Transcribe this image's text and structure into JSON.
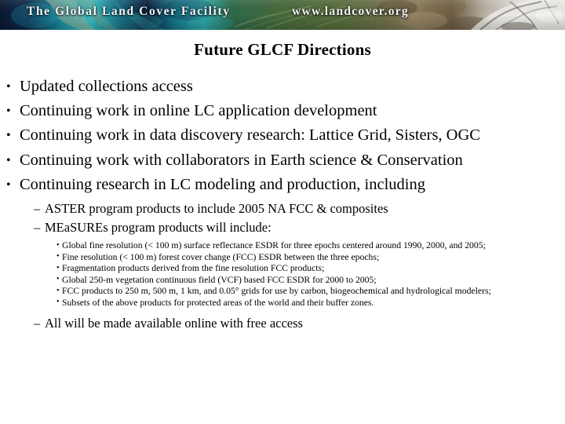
{
  "banner": {
    "title": "The Global Land Cover Facility",
    "url": "www.landcover.org",
    "colors": {
      "ocean_dark": "#0b1d3a",
      "ocean_teal": "#1fa0a8",
      "ocean_cyan": "#3fc7c9",
      "land_green": "#4d6b3a",
      "land_tan": "#8d7a5a",
      "snow_white": "#e8e8e6",
      "text": "#f2f6f8"
    }
  },
  "slide": {
    "title": "Future GLCF Directions"
  },
  "bullets": [
    {
      "text": "Updated collections access"
    },
    {
      "text": "Continuing work in online LC application development"
    },
    {
      "text": "Continuing work in data discovery research: Lattice Grid, Sisters, OGC"
    },
    {
      "text": "Continuing work with collaborators in Earth science & Conservation"
    },
    {
      "text": "Continuing research in LC modeling and production, including"
    }
  ],
  "sub_bullets": [
    {
      "text": "ASTER program products to include 2005 NA FCC & composites"
    },
    {
      "text": "MEaSUREs program products will include:"
    }
  ],
  "detail_bullets": [
    {
      "text": "Global fine resolution (< 100 m) surface reflectance ESDR for three epochs centered around 1990, 2000, and 2005;"
    },
    {
      "text": "Fine resolution (< 100 m) forest cover change (FCC) ESDR between the three epochs;"
    },
    {
      "text": "Fragmentation products derived from the fine resolution FCC products;"
    },
    {
      "text": "Global 250-m vegetation continuous field (VCF) based FCC ESDR for 2000 to 2005;"
    },
    {
      "text": "FCC products to 250 m, 500 m, 1 km, and 0.05° grids for use by carbon, biogeochemical and hydrological modelers;"
    },
    {
      "text": "Subsets of the above products for protected areas of the world and their buffer zones."
    }
  ],
  "closing_bullets": [
    {
      "text": "All will be made available online with free access"
    }
  ]
}
